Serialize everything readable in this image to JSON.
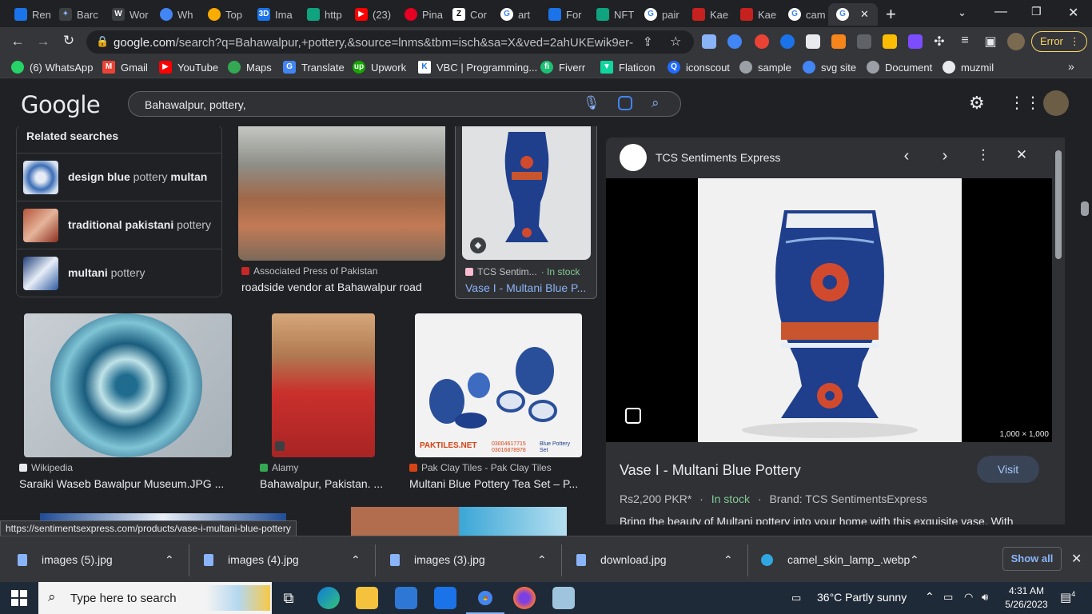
{
  "tabs": [
    {
      "label": "Ren",
      "color": "#1a73e8"
    },
    {
      "label": "Barc",
      "color": "#8ab4f8"
    },
    {
      "label": "Wor",
      "color": "#e8eaed"
    },
    {
      "label": "Wh",
      "color": "#4285f4"
    },
    {
      "label": "Top",
      "color": "#f9ab00"
    },
    {
      "label": "Ima",
      "color": "#1a73e8"
    },
    {
      "label": "http",
      "color": "#10a37f"
    },
    {
      "label": "(23)",
      "color": "#ff0000"
    },
    {
      "label": "Pina",
      "color": "#e60023"
    },
    {
      "label": "Cor",
      "color": "#ffffff"
    },
    {
      "label": "art",
      "color": "#4285f4"
    },
    {
      "label": "For",
      "color": "#1a73e8"
    },
    {
      "label": "NFT",
      "color": "#10a37f"
    },
    {
      "label": "pair",
      "color": "#4285f4"
    },
    {
      "label": "Kae",
      "color": "#c5221f"
    },
    {
      "label": "Kae",
      "color": "#c5221f"
    },
    {
      "label": "cam",
      "color": "#4285f4"
    },
    {
      "label": "",
      "color": "#4285f4"
    }
  ],
  "toolbar": {
    "url_host": "google.com",
    "url_rest": "/search?q=Bahawalpur,+pottery,&source=lnms&tbm=isch&sa=X&ved=2ahUKEwik9er-8JL_...",
    "error_label": "Error"
  },
  "bookmarks": [
    {
      "label": "(6) WhatsApp",
      "color": "#25d366"
    },
    {
      "label": "Gmail",
      "color": "#ea4335"
    },
    {
      "label": "YouTube",
      "color": "#ff0000"
    },
    {
      "label": "Maps",
      "color": "#34a853"
    },
    {
      "label": "Translate",
      "color": "#4285f4"
    },
    {
      "label": "Upwork",
      "color": "#14a800"
    },
    {
      "label": "VBC | Programming...",
      "color": "#1a73e8"
    },
    {
      "label": "Fiverr",
      "color": "#1dbf73"
    },
    {
      "label": "Flaticon",
      "color": "#0fd59f"
    },
    {
      "label": "iconscout",
      "color": "#1f6bff"
    },
    {
      "label": "sample",
      "color": "#9aa0a6"
    },
    {
      "label": "svg site",
      "color": "#4285f4"
    },
    {
      "label": "Document",
      "color": "#9aa0a6"
    },
    {
      "label": "muzmil",
      "color": "#e8eaed"
    }
  ],
  "google": {
    "logo": "Google",
    "query": "Bahawalpur, pottery,"
  },
  "related": {
    "heading": "Related searches",
    "items": [
      {
        "bold": "design blue",
        "rest": " pottery ",
        "bold2": "multan"
      },
      {
        "bold": "traditional pakistani",
        "rest": " pottery",
        "bold2": ""
      },
      {
        "bold": "multani",
        "rest": " pottery",
        "bold2": ""
      }
    ]
  },
  "results": [
    {
      "source": "Associated Press of Pakistan",
      "title": "roadside vendor at Bahawalpur road"
    },
    {
      "source": "TCS Sentim...",
      "stock": "· In stock",
      "title": "Vase I - Multani Blue P..."
    },
    {
      "source": "Wikipedia",
      "title": "Saraiki Waseb Bawalpur Museum.JPG ..."
    },
    {
      "source": "Alamy",
      "title": "Bahawalpur, Pakistan. ..."
    },
    {
      "source": "Pak Clay Tiles - Pak Clay Tiles",
      "title": "Multani Blue Pottery Tea Set – P..."
    }
  ],
  "paktiles_text": {
    "brand": "PAKTILES.NET",
    "phones": "03004617715\n03016878978",
    "caption": "Blue Pottery\nSet"
  },
  "panel": {
    "site": "TCS Sentiments Express",
    "dimensions": "1,000 × 1,000",
    "title": "Vase I - Multani Blue Pottery",
    "visit": "Visit",
    "price": "Rs2,200 PKR*",
    "stock": "In stock",
    "brand": "Brand: TCS SentimentsExpress",
    "description": "Bring the beauty of Multani pottery into your home with this exquisite vase. With"
  },
  "status_url": "https://sentimentsexpress.com/products/vase-i-multani-blue-pottery",
  "downloads": [
    {
      "name": "images (5).jpg"
    },
    {
      "name": "images (4).jpg"
    },
    {
      "name": "images (3).jpg"
    },
    {
      "name": "download.jpg"
    },
    {
      "name": "camel_skin_lamp_.webp"
    }
  ],
  "show_all": "Show all",
  "taskbar": {
    "search_placeholder": "Type here to search",
    "weather": "36°C  Partly sunny",
    "time": "4:31 AM",
    "date": "5/26/2023",
    "notifications": "4"
  }
}
